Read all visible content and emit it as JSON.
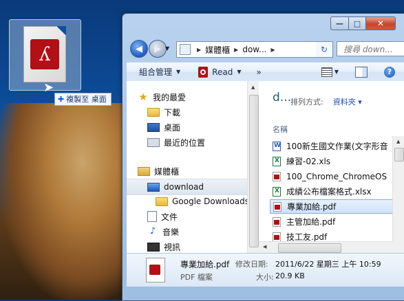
{
  "drag": {
    "tooltip": "複製至 桌面",
    "icon": "pdf-file-icon"
  },
  "window": {
    "caption_min": "—",
    "caption_max": "□",
    "caption_close": "✕"
  },
  "address": {
    "crumbs": [
      "媒體櫃",
      "dow..."
    ],
    "search_placeholder": "搜尋 down..."
  },
  "toolbar": {
    "organize": "組合管理",
    "read": "Read",
    "more": "»"
  },
  "nav": {
    "favorites": "我的最愛",
    "downloads": "下載",
    "desktop": "桌面",
    "recent": "最近的位置",
    "libraries": "媒體櫃",
    "download": "download",
    "google_downloads": "Google Downloads",
    "documents": "文件",
    "music": "音樂",
    "videos": "視訊"
  },
  "content": {
    "library_title": "d...",
    "arrange_label": "排列方式:",
    "arrange_value": "資料夾 ▾",
    "column_name": "名稱",
    "files": [
      {
        "name": "100新生國文作業(文字形音",
        "type": "word"
      },
      {
        "name": "練習-02.xls",
        "type": "excel"
      },
      {
        "name": "100_Chrome_ChromeOS",
        "type": "pdf"
      },
      {
        "name": "成績公布檔案格式.xlsx",
        "type": "excel"
      },
      {
        "name": "專業加給.pdf",
        "type": "pdf",
        "selected": true
      },
      {
        "name": "主管加給.pdf",
        "type": "pdf"
      },
      {
        "name": "技工友.pdf",
        "type": "pdf"
      }
    ]
  },
  "details": {
    "name": "專業加給.pdf",
    "type": "PDF 檔案",
    "modified_label": "修改日期:",
    "modified_value": "2011/6/22 星期三 上午 10:59",
    "size_label": "大小:",
    "size_value": "20.9 KB"
  }
}
